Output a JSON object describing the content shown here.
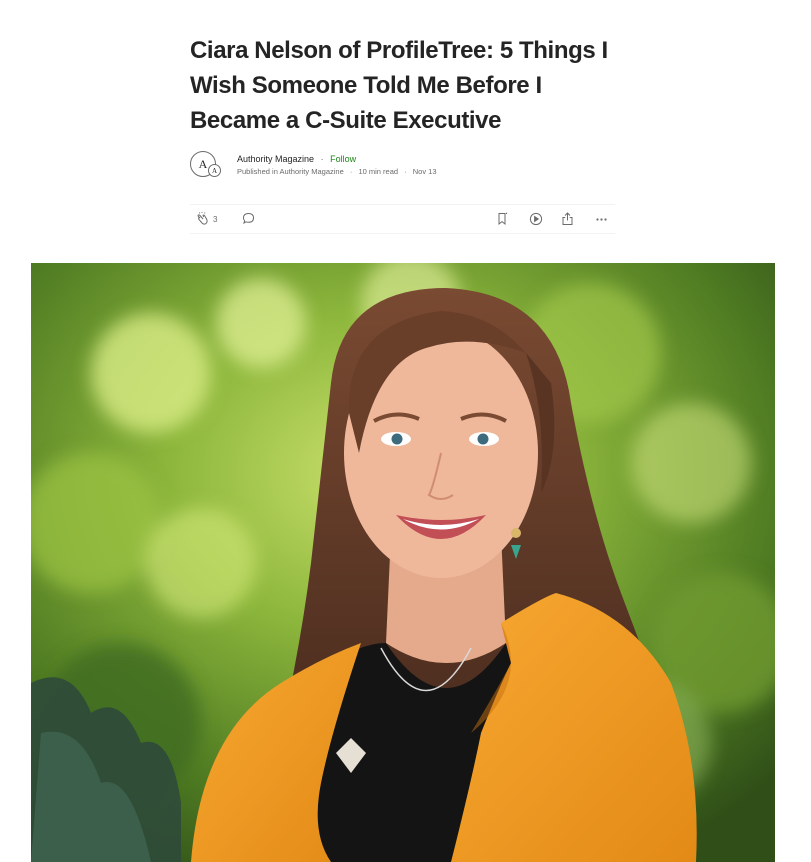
{
  "article": {
    "title": "Ciara Nelson of ProfileTree: 5 Things I Wish Someone Told Me Before I Became a C-Suite Executive"
  },
  "byline": {
    "avatar_letter": "A",
    "author": "Authority Magazine",
    "separator": "·",
    "follow_label": "Follow",
    "published_prefix": "Published in",
    "publication": "Authority Magazine",
    "read_time": "10 min read",
    "date": "Nov 13"
  },
  "actions": {
    "clap_count": "3",
    "icons": [
      "clap-icon",
      "comment-icon",
      "bookmark-icon",
      "play-icon",
      "share-icon",
      "more-icon"
    ]
  },
  "hero": {
    "icon": "portrait-photo",
    "colors": {
      "background_green": "#6f9a2c",
      "blazer_orange": "#f39a24",
      "hair_brown": "#6a3f2a",
      "skin": "#efb89a",
      "top_black": "#141414"
    }
  },
  "colors": {
    "text": "#242424",
    "muted": "#6b6b6b",
    "follow_green": "#1a8917",
    "divider": "#f2f2f2"
  }
}
